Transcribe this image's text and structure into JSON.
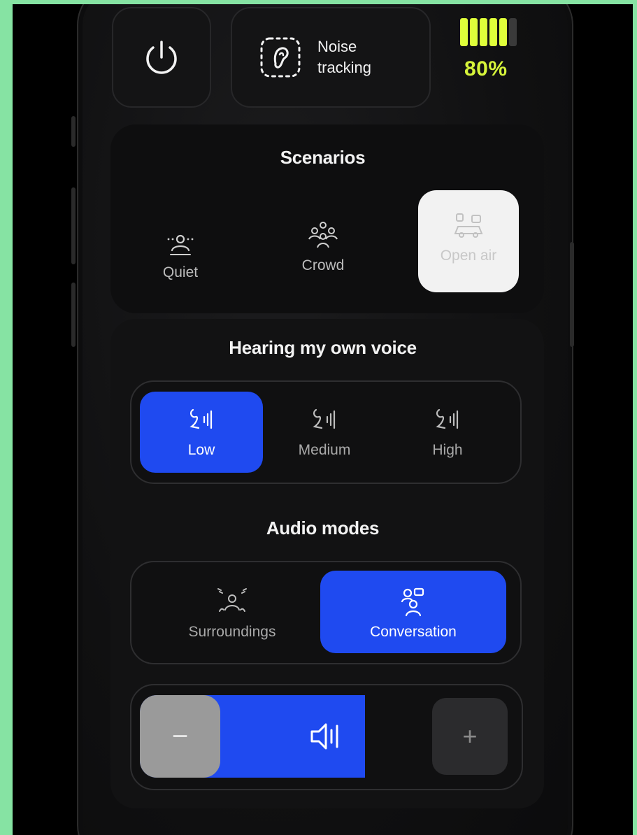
{
  "top": {
    "noise_tracking_line1": "Noise",
    "noise_tracking_line2": "tracking",
    "battery_percent": "80%",
    "battery_level": 0.8,
    "battery_color": "#dfff3a"
  },
  "scenarios": {
    "title": "Scenarios",
    "items": [
      {
        "label": "Quiet",
        "icon": "quiet-person-icon",
        "active": false
      },
      {
        "label": "Crowd",
        "icon": "crowd-icon",
        "active": false
      },
      {
        "label": "Open air",
        "icon": "open-air-car-icon",
        "active": true
      }
    ]
  },
  "own_voice": {
    "title": "Hearing my own voice",
    "options": [
      {
        "label": "Low",
        "icon": "voice-level-icon",
        "active": true
      },
      {
        "label": "Medium",
        "icon": "voice-level-icon",
        "active": false
      },
      {
        "label": "High",
        "icon": "voice-level-icon",
        "active": false
      }
    ]
  },
  "audio_modes": {
    "title": "Audio modes",
    "options": [
      {
        "label": "Surroundings",
        "icon": "surroundings-icon",
        "active": false
      },
      {
        "label": "Conversation",
        "icon": "conversation-icon",
        "active": true
      }
    ]
  },
  "volume": {
    "minus_label": "−",
    "plus_label": "+",
    "level": 0.6,
    "accent": "#1f4af0"
  }
}
